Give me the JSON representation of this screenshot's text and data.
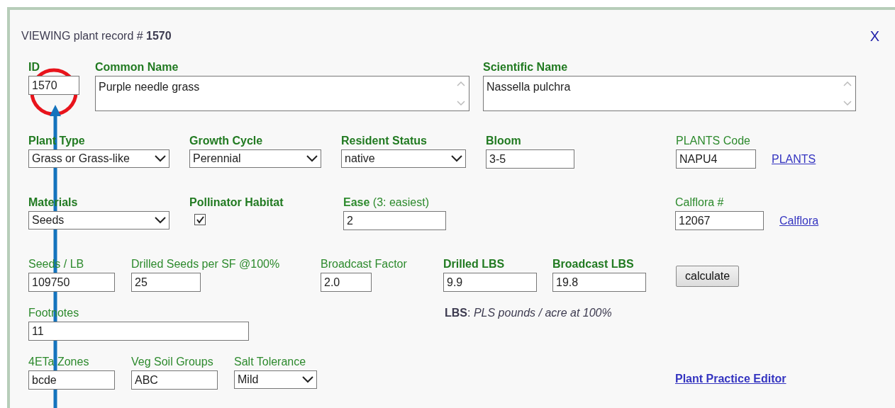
{
  "dialog": {
    "title": "VIEWING plant record # **1570**",
    "close": "X"
  },
  "rows": [
    [
      {
        "kind": "text",
        "label": "ID",
        "bold": true,
        "value": "1570"
      },
      {
        "kind": "textarea",
        "label": "Common Name",
        "bold": true,
        "value": "Purple needle grass"
      },
      {
        "kind": "textarea",
        "label": "Scientific Name",
        "bold": true,
        "value": "Nassella pulchra"
      }
    ],
    [
      {
        "kind": "select",
        "label": "Plant Type",
        "bold": true,
        "value": "Grass or Grass-like"
      },
      {
        "kind": "select",
        "label": "Growth Cycle",
        "bold": true,
        "value": "Perennial"
      },
      {
        "kind": "select",
        "label": "Resident Status",
        "bold": true,
        "value": "native"
      },
      {
        "kind": "text",
        "label": "Bloom",
        "bold": true,
        "value": "3-5"
      },
      {
        "kind": "text",
        "label": "PLANTS Code",
        "bold": false,
        "value": "NAPU4",
        "link": "PLANTS"
      }
    ],
    [
      {
        "kind": "select",
        "label": "Materials",
        "bold": true,
        "value": "Seeds"
      },
      {
        "kind": "checkbox",
        "label": "Pollinator Habitat",
        "bold": true,
        "checked": true
      },
      {
        "kind": "text",
        "label": "**Ease** (3: easiest)",
        "bold": false,
        "value": "2"
      },
      {
        "kind": "text",
        "label": "Calflora #",
        "bold": false,
        "value": "12067",
        "link": "Calflora"
      }
    ],
    [
      {
        "kind": "text",
        "label": "Seeds / LB",
        "bold": false,
        "value": "109750"
      },
      {
        "kind": "text",
        "label": "Drilled Seeds per SF @100%",
        "bold": false,
        "value": "25"
      },
      {
        "kind": "text",
        "label": "Broadcast Factor",
        "bold": false,
        "value": "2.0"
      },
      {
        "kind": "text",
        "label": "Drilled LBS",
        "bold": true,
        "value": "9.9"
      },
      {
        "kind": "text",
        "label": "Broadcast LBS",
        "bold": true,
        "value": "19.8"
      },
      {
        "kind": "button",
        "value": "calculate"
      }
    ],
    [
      {
        "kind": "text",
        "label": "Footnotes",
        "bold": false,
        "value": "11"
      },
      {
        "kind": "note",
        "value": "**LBS**: *PLS pounds / acre at 100%*"
      }
    ],
    [
      {
        "kind": "text",
        "label": "4ETa Zones",
        "bold": false,
        "value": "bcde"
      },
      {
        "kind": "text",
        "label": "Veg Soil Groups",
        "bold": false,
        "value": "ABC"
      },
      {
        "kind": "select",
        "label": "Salt Tolerance",
        "bold": false,
        "value": "Mild"
      },
      {
        "kind": "link",
        "value": "Plant Practice Editor"
      }
    ]
  ]
}
